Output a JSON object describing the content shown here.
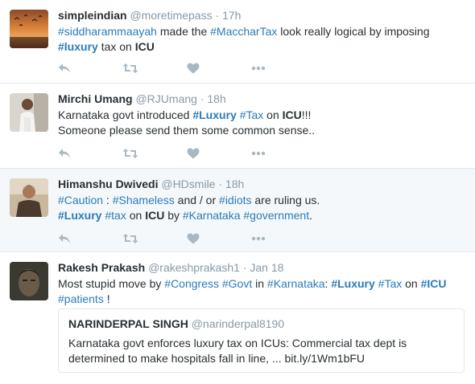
{
  "tweets": [
    {
      "fullname": "simpleindian",
      "username": "@moretimepass",
      "separator": "·",
      "time": "17h",
      "line1": {
        "h1": "#siddharammaayah",
        "t1": " made the ",
        "h2": "#MaccharTax",
        "t2": " look really logical by imposing"
      },
      "line2": {
        "h1": "#luxury",
        "t1": " tax on ",
        "b1": "ICU"
      }
    },
    {
      "fullname": "Mirchi Umang",
      "username": "@RJUmang",
      "separator": "·",
      "time": "18h",
      "line1": {
        "t1": "Karnataka govt introduced ",
        "h1": "#Luxury",
        "t2": " ",
        "h2": "#Tax",
        "t3": " on ",
        "b1": "ICU",
        "t4": "!!!"
      },
      "line2": {
        "t1": "Someone please send them some common sense.."
      }
    },
    {
      "fullname": "Himanshu Dwivedi",
      "username": "@HDsmile",
      "separator": "·",
      "time": "18h",
      "line1": {
        "h1": "#Caution",
        "t1": " : ",
        "h2": "#Shameless",
        "t2": " and / or ",
        "h3": "#idiots",
        "t3": " are ruling us."
      },
      "line2": {
        "h1": "#Luxury",
        "t1": " ",
        "h2": "#tax",
        "t2": " on ",
        "b1": "ICU",
        "t3": " by ",
        "h3": "#Karnataka",
        "t4": " ",
        "h4": "#government",
        "t5": "."
      }
    },
    {
      "fullname": "Rakesh Prakash",
      "username": "@rakeshprakash1",
      "separator": "·",
      "time": "Jan 18",
      "line1": {
        "t1": "Most stupid move by ",
        "h1": "#Congress",
        "t2": " ",
        "h2": "#Govt",
        "t3": " in ",
        "h3": "#Karnataka",
        "t4": ": ",
        "h4": "#Luxury",
        "t5": " ",
        "h5": "#Tax",
        "t6": " on ",
        "h6": "#ICU"
      },
      "line2": {
        "h1": "#patients",
        "t1": " !"
      },
      "quote": {
        "fullname": "NARINDERPAL SINGH",
        "username": "@narinderpal8190",
        "line1": "Karnataka govt enforces luxury tax on ICUs: Commercial tax dept is",
        "line2": "determined to make hospitals fall in line, ... bit.ly/1Wm1bFU"
      }
    }
  ],
  "icons": [
    "reply-icon",
    "retweet-icon",
    "like-icon",
    "more-icon"
  ],
  "colors": {
    "hashtag": "#2b7bb9",
    "text": "#292f33",
    "muted": "#8899a6",
    "icon": "#aab8c2",
    "border": "#e1e8ed",
    "highlight_bg": "#f5f8fa"
  }
}
